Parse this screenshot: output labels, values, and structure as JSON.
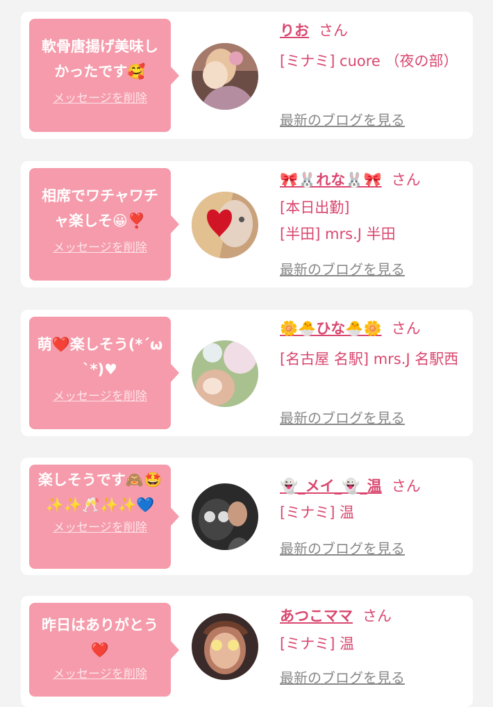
{
  "colors": {
    "accent": "#d9466e",
    "bubble": "#f59bab",
    "card": "#ffffff",
    "background": "#f3f3f3",
    "link_gray": "#888888"
  },
  "common": {
    "delete_label": "メッセージを削除",
    "honorific": "さん",
    "blog_label": "最新のブログを見る"
  },
  "messages": [
    {
      "text": "軟骨唐揚げ美味しかったです🥰",
      "name": "りお",
      "shop_lines": [
        "[ミナミ] cuore （夜の部）"
      ]
    },
    {
      "text": "相席でワチャワチャ楽しそ😀❣️",
      "name": "🎀🐰れな🐰🎀",
      "shop_lines": [
        "[本日出勤]",
        "[半田] mrs.J 半田"
      ]
    },
    {
      "text": "萌❤️楽しそう(*´ω`*)♥",
      "name": "🌼🐣ひな🐣🌼",
      "shop_lines": [
        "[名古屋 名駅] mrs.J 名駅西"
      ]
    },
    {
      "text": "楽しそうです🙈🤩✨✨🥂✨✨💙",
      "name": "👻_メイ_👻_温",
      "shop_lines": [
        "[ミナミ] 温"
      ]
    },
    {
      "text": "昨日はありがとう❤️",
      "name": "あつこママ",
      "shop_lines": [
        "[ミナミ] 温"
      ]
    }
  ]
}
